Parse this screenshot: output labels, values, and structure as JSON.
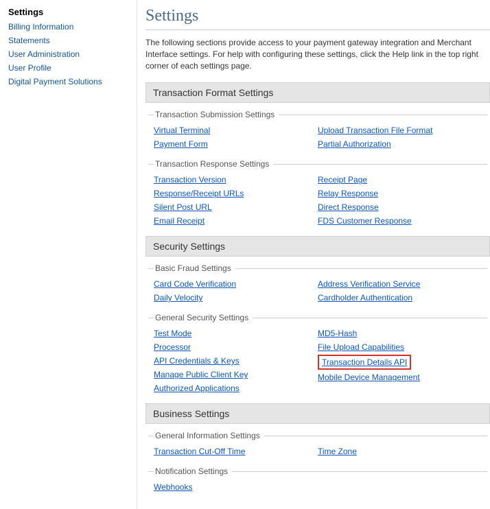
{
  "sidebar": {
    "title": "Settings",
    "items": [
      "Billing Information",
      "Statements",
      "User Administration",
      "User Profile",
      "Digital Payment Solutions"
    ]
  },
  "page": {
    "title": "Settings",
    "intro": "The following sections provide access to your payment gateway integration and Merchant Interface settings. For help with configuring these settings, click the Help link in the top right corner of each settings page."
  },
  "sections": {
    "transaction": {
      "header": "Transaction Format Settings",
      "groups": [
        {
          "legend": "Transaction Submission Settings",
          "left": [
            "Virtual Terminal",
            "Payment Form"
          ],
          "right": [
            "Upload Transaction File Format",
            "Partial Authorization"
          ]
        },
        {
          "legend": "Transaction Response Settings",
          "left": [
            "Transaction Version",
            "Response/Receipt URLs",
            "Silent Post URL",
            "Email Receipt"
          ],
          "right": [
            "Receipt Page",
            "Relay Response",
            "Direct Response",
            "FDS Customer Response"
          ]
        }
      ]
    },
    "security": {
      "header": "Security Settings",
      "groups": [
        {
          "legend": "Basic Fraud Settings",
          "left": [
            "Card Code Verification",
            "Daily Velocity"
          ],
          "right": [
            "Address Verification Service",
            "Cardholder Authentication"
          ]
        },
        {
          "legend": "General Security Settings",
          "left": [
            "Test Mode",
            "Processor",
            "API Credentials & Keys",
            "Manage Public Client Key",
            "Authorized Applications"
          ],
          "right": [
            "MD5-Hash",
            "File Upload Capabilities",
            "Transaction Details API",
            "Mobile Device Management"
          ],
          "highlightRight": 2
        }
      ]
    },
    "business": {
      "header": "Business Settings",
      "groups": [
        {
          "legend": "General Information Settings",
          "left": [
            "Transaction Cut-Off Time"
          ],
          "right": [
            "Time Zone"
          ]
        },
        {
          "legend": "Notification Settings",
          "left": [
            "Webhooks"
          ],
          "right": []
        }
      ]
    }
  }
}
